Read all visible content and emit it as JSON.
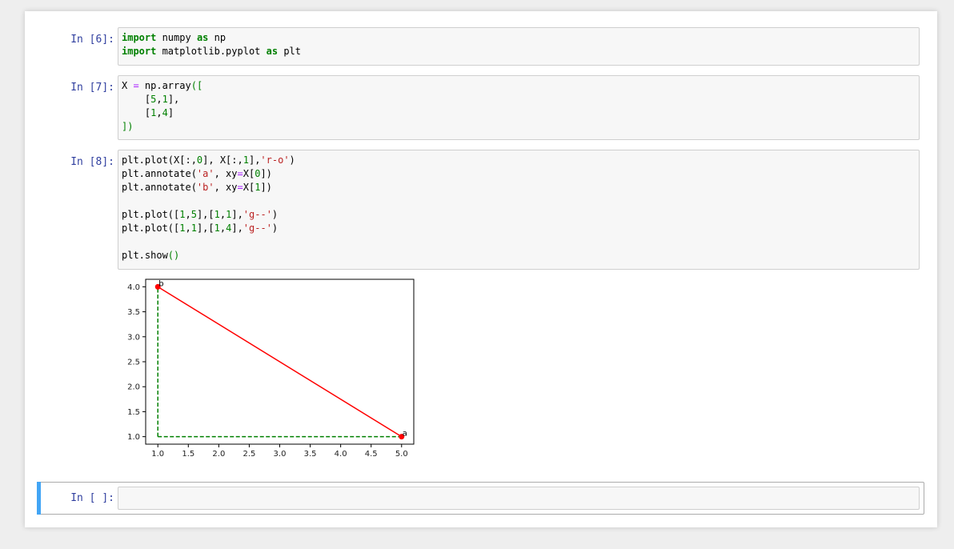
{
  "cells": [
    {
      "prompt": "In [6]:",
      "lines": [
        [
          {
            "t": "import",
            "c": "kw"
          },
          {
            "t": " numpy "
          },
          {
            "t": "as",
            "c": "kw"
          },
          {
            "t": " np"
          }
        ],
        [
          {
            "t": "import",
            "c": "kw"
          },
          {
            "t": " matplotlib.pyplot "
          },
          {
            "t": "as",
            "c": "kw"
          },
          {
            "t": " plt"
          }
        ]
      ]
    },
    {
      "prompt": "In [7]:",
      "lines": [
        [
          {
            "t": "X "
          },
          {
            "t": "=",
            "c": "op"
          },
          {
            "t": " np.array"
          },
          {
            "t": "([",
            "c": "par"
          }
        ],
        [
          {
            "t": "    [",
            "c": ""
          },
          {
            "t": "5",
            "c": "num"
          },
          {
            "t": ","
          },
          {
            "t": "1",
            "c": "num"
          },
          {
            "t": "],"
          }
        ],
        [
          {
            "t": "    [",
            "c": ""
          },
          {
            "t": "1",
            "c": "num"
          },
          {
            "t": ","
          },
          {
            "t": "4",
            "c": "num"
          },
          {
            "t": "]"
          }
        ],
        [
          {
            "t": "])",
            "c": "par"
          }
        ]
      ]
    },
    {
      "prompt": "In [8]:",
      "lines": [
        [
          {
            "t": "plt.plot(X[:,"
          },
          {
            "t": "0",
            "c": "num"
          },
          {
            "t": "], X[:,"
          },
          {
            "t": "1",
            "c": "num"
          },
          {
            "t": "],"
          },
          {
            "t": "'r-o'",
            "c": "str"
          },
          {
            "t": ")"
          }
        ],
        [
          {
            "t": "plt.annotate("
          },
          {
            "t": "'a'",
            "c": "str"
          },
          {
            "t": ", xy"
          },
          {
            "t": "=",
            "c": "op"
          },
          {
            "t": "X["
          },
          {
            "t": "0",
            "c": "num"
          },
          {
            "t": "])"
          }
        ],
        [
          {
            "t": "plt.annotate("
          },
          {
            "t": "'b'",
            "c": "str"
          },
          {
            "t": ", xy"
          },
          {
            "t": "=",
            "c": "op"
          },
          {
            "t": "X["
          },
          {
            "t": "1",
            "c": "num"
          },
          {
            "t": "])"
          }
        ],
        [],
        [
          {
            "t": "plt.plot(["
          },
          {
            "t": "1",
            "c": "num"
          },
          {
            "t": ","
          },
          {
            "t": "5",
            "c": "num"
          },
          {
            "t": "],["
          },
          {
            "t": "1",
            "c": "num"
          },
          {
            "t": ","
          },
          {
            "t": "1",
            "c": "num"
          },
          {
            "t": "],"
          },
          {
            "t": "'g--'",
            "c": "str"
          },
          {
            "t": ")"
          }
        ],
        [
          {
            "t": "plt.plot(["
          },
          {
            "t": "1",
            "c": "num"
          },
          {
            "t": ","
          },
          {
            "t": "1",
            "c": "num"
          },
          {
            "t": "],["
          },
          {
            "t": "1",
            "c": "num"
          },
          {
            "t": ","
          },
          {
            "t": "4",
            "c": "num"
          },
          {
            "t": "],"
          },
          {
            "t": "'g--'",
            "c": "str"
          },
          {
            "t": ")"
          }
        ],
        [],
        [
          {
            "t": "plt.show"
          },
          {
            "t": "()",
            "c": "par"
          }
        ]
      ]
    }
  ],
  "empty_cell": {
    "prompt": "In [ ]:"
  },
  "chart_data": {
    "type": "line",
    "xlim": [
      0.8,
      5.2
    ],
    "ylim": [
      0.85,
      4.15
    ],
    "xticks": [
      "1.0",
      "1.5",
      "2.0",
      "2.5",
      "3.0",
      "3.5",
      "4.0",
      "4.5",
      "5.0"
    ],
    "yticks": [
      "1.0",
      "1.5",
      "2.0",
      "2.5",
      "3.0",
      "3.5",
      "4.0"
    ],
    "series": [
      {
        "style": "r-o",
        "color": "#ff0000",
        "x": [
          5,
          1
        ],
        "y": [
          1,
          4
        ],
        "marker": true,
        "dashed": false
      },
      {
        "style": "g--",
        "color": "#008000",
        "x": [
          1,
          5
        ],
        "y": [
          1,
          1
        ],
        "marker": false,
        "dashed": true
      },
      {
        "style": "g--",
        "color": "#008000",
        "x": [
          1,
          1
        ],
        "y": [
          1,
          4
        ],
        "marker": false,
        "dashed": true
      }
    ],
    "annotations": [
      {
        "text": "a",
        "x": 5,
        "y": 1
      },
      {
        "text": "b",
        "x": 1,
        "y": 4
      }
    ],
    "grid": false
  }
}
